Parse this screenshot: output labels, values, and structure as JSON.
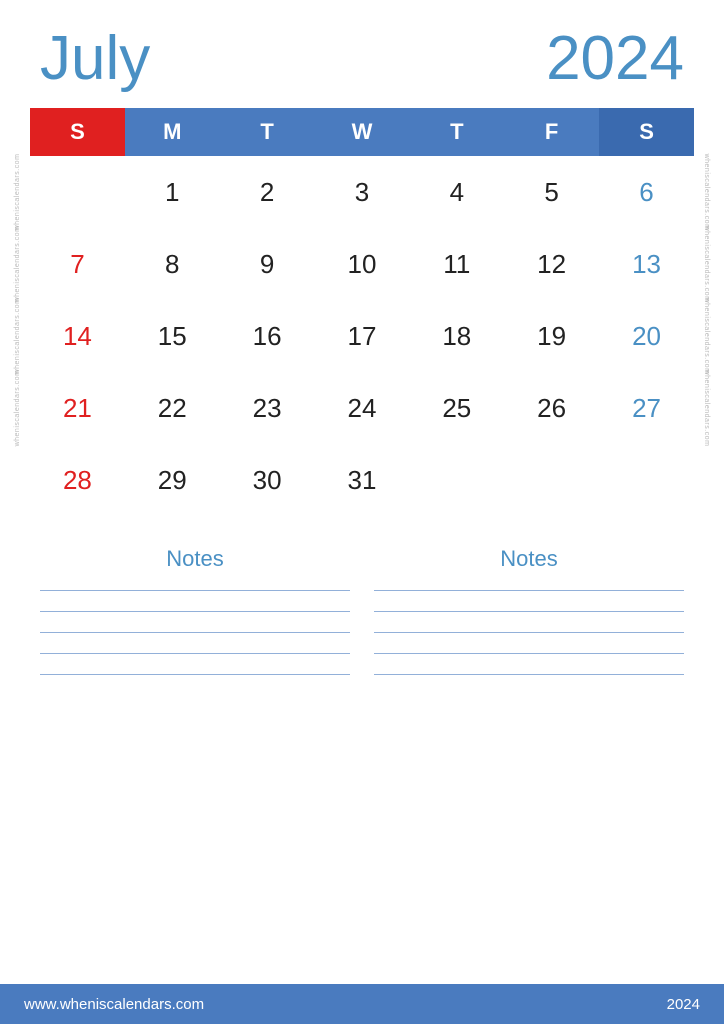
{
  "header": {
    "month": "July",
    "year": "2024"
  },
  "calendar": {
    "days": [
      "S",
      "M",
      "T",
      "W",
      "T",
      "F",
      "S"
    ],
    "weeks": [
      [
        "",
        "1",
        "2",
        "3",
        "4",
        "5",
        "6"
      ],
      [
        "7",
        "8",
        "9",
        "10",
        "11",
        "12",
        "13"
      ],
      [
        "14",
        "15",
        "16",
        "17",
        "18",
        "19",
        "20"
      ],
      [
        "21",
        "22",
        "23",
        "24",
        "25",
        "26",
        "27"
      ],
      [
        "28",
        "29",
        "30",
        "31",
        "",
        "",
        ""
      ]
    ],
    "week_labels": [
      "w h e n i s c a l e n d a r s . c o m",
      "w h e n i s c a l e n d a r s . c o m",
      "w h e n i s c a l e n d a r s . c o m",
      "w h e n i s c a l e n d a r s . c o m"
    ]
  },
  "notes": [
    {
      "label": "Notes"
    },
    {
      "label": "Notes"
    }
  ],
  "footer": {
    "url": "www.wheniscalendars.com",
    "year": "2024"
  }
}
